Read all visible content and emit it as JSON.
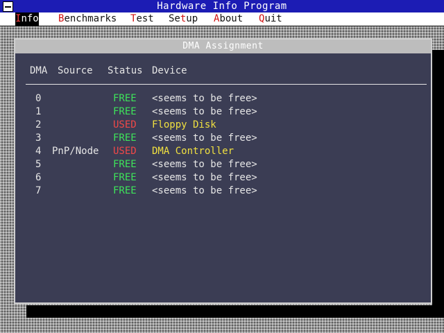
{
  "window": {
    "title": "Hardware Info Program"
  },
  "menu": {
    "items": [
      {
        "hot": "I",
        "rest": "nfo",
        "active": true
      },
      {
        "hot": "B",
        "rest": "enchmarks",
        "active": false
      },
      {
        "hot": "T",
        "rest": "est",
        "active": false
      },
      {
        "pre": "Se",
        "hot": "t",
        "rest": "up",
        "active": false
      },
      {
        "hot": "A",
        "rest": "bout",
        "active": false
      },
      {
        "hot": "Q",
        "rest": "uit",
        "active": false
      }
    ]
  },
  "dialog": {
    "title": "DMA Assignment",
    "headers": {
      "dma": "DMA",
      "source": "Source",
      "status": "Status",
      "device": "Device"
    },
    "rows": [
      {
        "dma": "0",
        "source": "",
        "status": "FREE",
        "device": "<seems to be free>"
      },
      {
        "dma": "1",
        "source": "",
        "status": "FREE",
        "device": "<seems to be free>"
      },
      {
        "dma": "2",
        "source": "",
        "status": "USED",
        "device": "Floppy Disk"
      },
      {
        "dma": "3",
        "source": "",
        "status": "FREE",
        "device": "<seems to be free>"
      },
      {
        "dma": "4",
        "source": "PnP/Node",
        "status": "USED",
        "device": "DMA Controller"
      },
      {
        "dma": "5",
        "source": "",
        "status": "FREE",
        "device": "<seems to be free>"
      },
      {
        "dma": "6",
        "source": "",
        "status": "FREE",
        "device": "<seems to be free>"
      },
      {
        "dma": "7",
        "source": "",
        "status": "FREE",
        "device": "<seems to be free>"
      }
    ]
  },
  "colors": {
    "title_bar": "#1c1cb4",
    "dialog_bg": "#3b3d54",
    "free": "#3ee45a",
    "used": "#f04848",
    "used_device": "#f0e040"
  }
}
